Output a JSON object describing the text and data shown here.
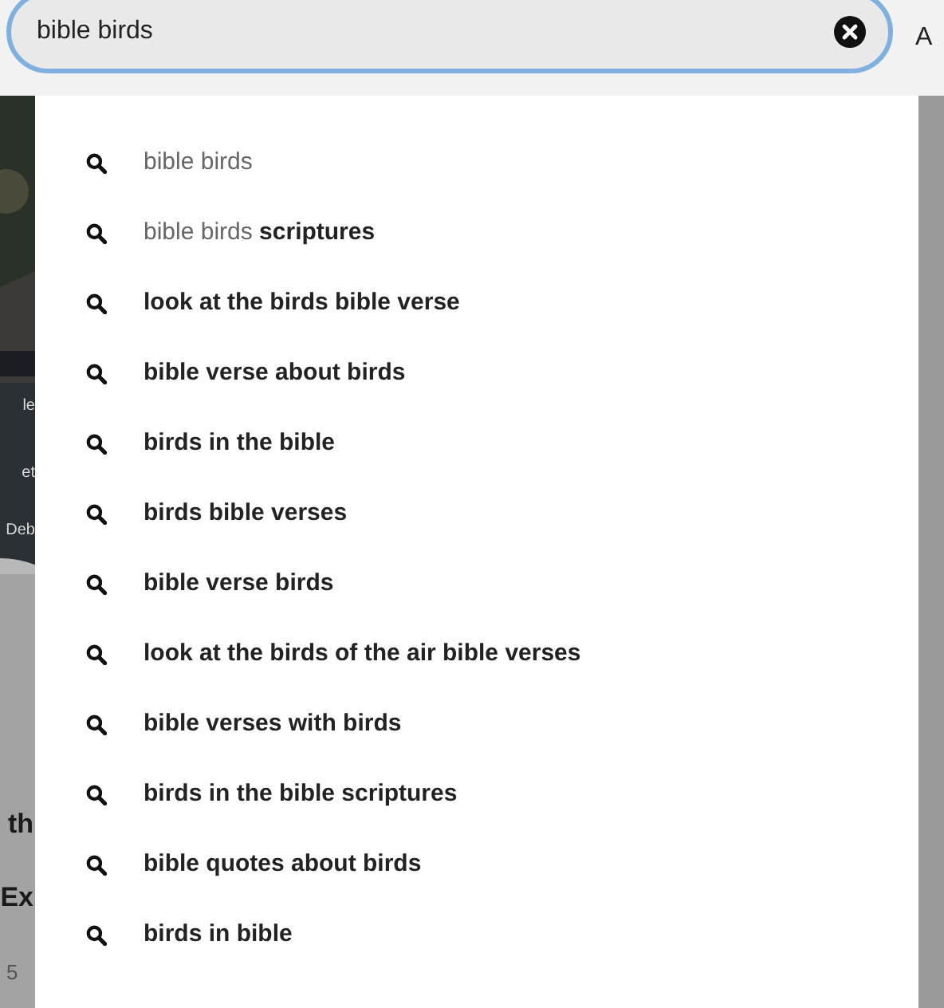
{
  "search": {
    "value": "bible birds"
  },
  "header_right": {
    "label": "A"
  },
  "background_card": {
    "overlay_texts": [
      "le",
      "et",
      "Deb"
    ],
    "title_lines": [
      "th",
      "Ex"
    ],
    "meta": "5"
  },
  "suggestions": [
    {
      "prefix": "bible birds"
    },
    {
      "prefix": "bible birds",
      "rest": "scriptures"
    },
    {
      "rest": "look at the birds bible verse"
    },
    {
      "rest": "bible verse about birds"
    },
    {
      "rest": "birds in the bible"
    },
    {
      "rest": "birds bible verses"
    },
    {
      "rest": "bible verse birds"
    },
    {
      "rest": "look at the birds of the air bible verses"
    },
    {
      "rest": "bible verses with birds"
    },
    {
      "rest": "birds in the bible scriptures"
    },
    {
      "rest": "bible quotes about birds"
    },
    {
      "rest": "birds in bible"
    }
  ]
}
